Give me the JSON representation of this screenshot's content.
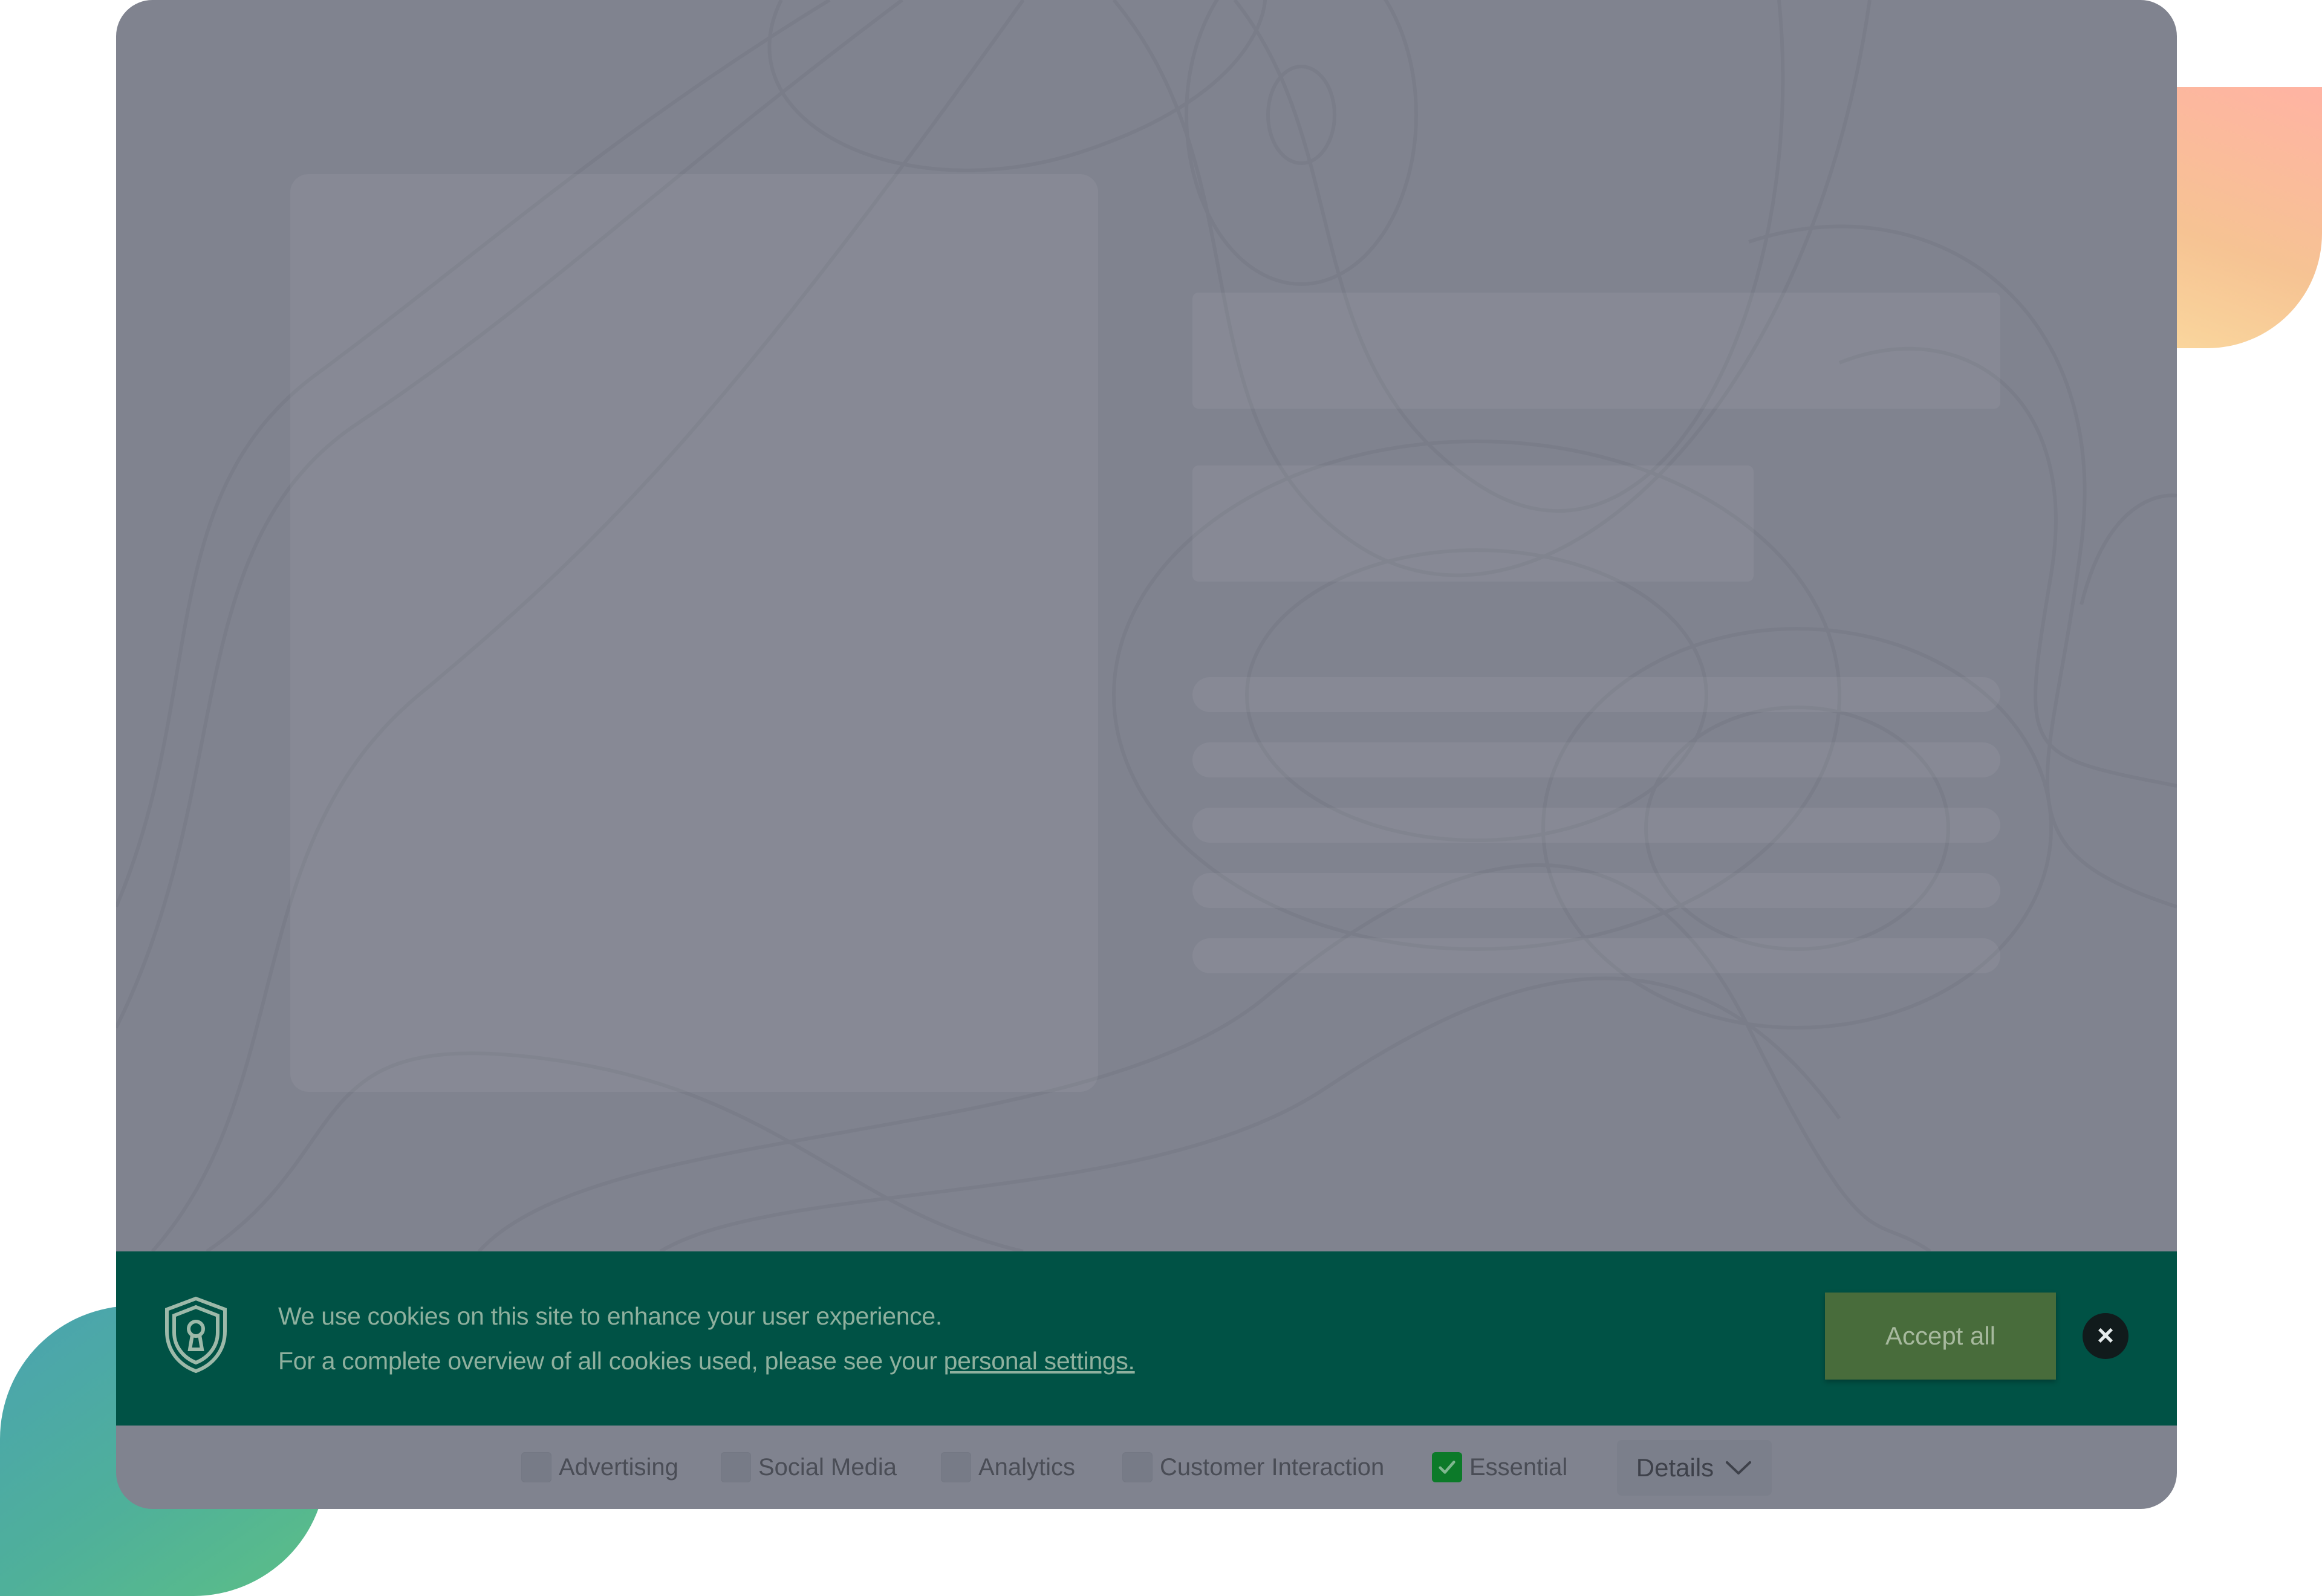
{
  "cookie_banner": {
    "line1": "We use cookies on this site to enhance your user experience.",
    "line2_prefix": "For a complete overview of all cookies used, please see your",
    "link_text": "personal settings.",
    "accept_label": "Accept all",
    "close_icon": "×"
  },
  "options": [
    {
      "label": "Advertising",
      "checked": false
    },
    {
      "label": "Social Media",
      "checked": false
    },
    {
      "label": "Analytics",
      "checked": false
    },
    {
      "label": "Customer Interaction",
      "checked": false
    },
    {
      "label": "Essential",
      "checked": true
    }
  ],
  "details": {
    "label": "Details",
    "icon": "chevron-down-icon"
  },
  "colors": {
    "banner": "#005245",
    "accept_button": "#486c3b",
    "overlay": "#80838f",
    "checked": "#0c7a29"
  }
}
